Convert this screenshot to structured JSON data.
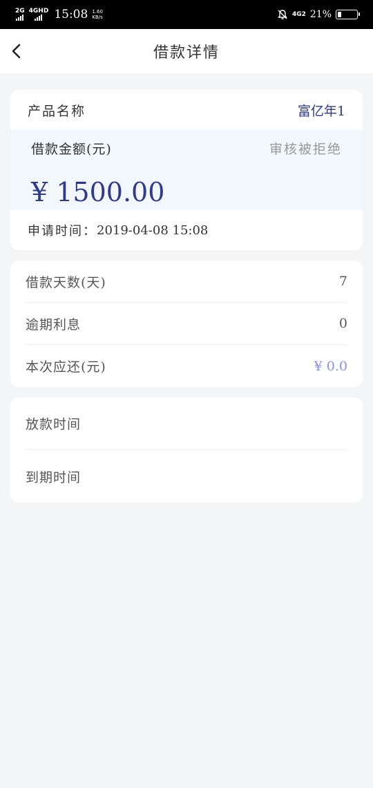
{
  "status_bar": {
    "net1": "2G",
    "net2": "4GHD",
    "time": "15:08",
    "speed_value": "1.60",
    "speed_unit": "KB/s",
    "net3": "4G2",
    "battery_percent": "21%",
    "battery_level": 0.21
  },
  "navbar": {
    "title": "借款详情"
  },
  "summary": {
    "product_label": "产品名称",
    "product_value": "富亿年1",
    "amount_label": "借款金额(元)",
    "status": "审核被拒绝",
    "amount": "¥ 1500.00",
    "apply_label": "申请时间：",
    "apply_time": "2019-04-08 15:08"
  },
  "details": [
    {
      "label": "借款天数(天)",
      "value": "7"
    },
    {
      "label": "逾期利息",
      "value": "0"
    },
    {
      "label": "本次应还(元)",
      "value": "¥ 0.0"
    }
  ],
  "times": [
    {
      "label": "放款时间",
      "value": ""
    },
    {
      "label": "到期时间",
      "value": ""
    }
  ],
  "colors": {
    "accent": "#2f3a8c",
    "highlight": "#8a90e8",
    "status_gray": "#999999"
  }
}
